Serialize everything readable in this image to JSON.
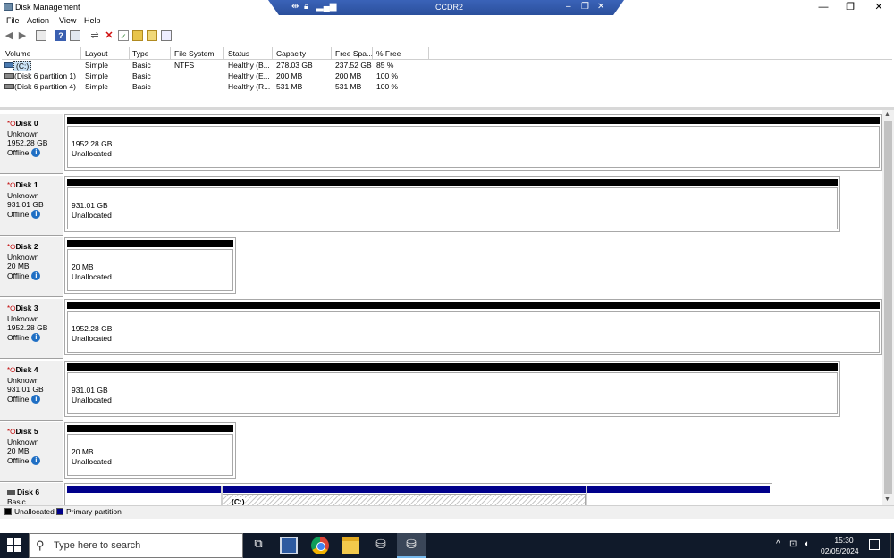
{
  "window": {
    "title": "Disk Management"
  },
  "remote": {
    "title": "CCDR2"
  },
  "menu": [
    "File",
    "Action",
    "View",
    "Help"
  ],
  "volumes": {
    "headers": [
      "Volume",
      "Layout",
      "Type",
      "File System",
      "Status",
      "Capacity",
      "Free Spa...",
      "% Free"
    ],
    "rows": [
      {
        "volume": "(C:)",
        "layout": "Simple",
        "type": "Basic",
        "fs": "NTFS",
        "status": "Healthy (B...",
        "capacity": "278.03 GB",
        "free": "237.52 GB",
        "pct": "85 %"
      },
      {
        "volume": "(Disk 6 partition 1)",
        "layout": "Simple",
        "type": "Basic",
        "fs": "",
        "status": "Healthy (E...",
        "capacity": "200 MB",
        "free": "200 MB",
        "pct": "100 %"
      },
      {
        "volume": "(Disk 6 partition 4)",
        "layout": "Simple",
        "type": "Basic",
        "fs": "",
        "status": "Healthy (R...",
        "capacity": "531 MB",
        "free": "531 MB",
        "pct": "100 %"
      }
    ]
  },
  "disks": [
    {
      "name": "Disk 0",
      "type": "Unknown",
      "size": "1952.28 GB",
      "state": "Offline",
      "part_size": "1952.28 GB",
      "part_label": "Unallocated"
    },
    {
      "name": "Disk 1",
      "type": "Unknown",
      "size": "931.01 GB",
      "state": "Offline",
      "part_size": "931.01 GB",
      "part_label": "Unallocated"
    },
    {
      "name": "Disk 2",
      "type": "Unknown",
      "size": "20 MB",
      "state": "Offline",
      "part_size": "20 MB",
      "part_label": "Unallocated"
    },
    {
      "name": "Disk 3",
      "type": "Unknown",
      "size": "1952.28 GB",
      "state": "Offline",
      "part_size": "1952.28 GB",
      "part_label": "Unallocated"
    },
    {
      "name": "Disk 4",
      "type": "Unknown",
      "size": "931.01 GB",
      "state": "Offline",
      "part_size": "931.01 GB",
      "part_label": "Unallocated"
    },
    {
      "name": "Disk 5",
      "type": "Unknown",
      "size": "20 MB",
      "state": "Offline",
      "part_size": "20 MB",
      "part_label": "Unallocated"
    },
    {
      "name": "Disk 6",
      "type": "Basic",
      "part_c": "(C:)"
    }
  ],
  "legend": {
    "unallocated": "Unallocated",
    "primary": "Primary partition",
    "unallocated_color": "#000000",
    "primary_color": "#00008b"
  },
  "taskbar": {
    "search_placeholder": "Type here to search",
    "time": "15:30",
    "date": "02/05/2024"
  }
}
